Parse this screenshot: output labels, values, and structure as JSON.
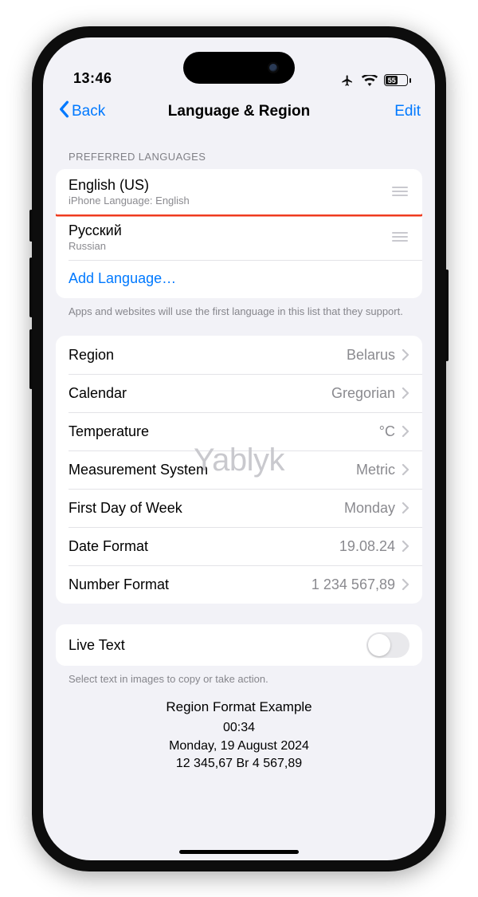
{
  "status": {
    "time": "13:46",
    "battery_pct": "55"
  },
  "nav": {
    "back": "Back",
    "title": "Language & Region",
    "edit": "Edit"
  },
  "languages": {
    "header": "PREFERRED LANGUAGES",
    "items": [
      {
        "title": "English (US)",
        "subtitle": "iPhone Language: English"
      },
      {
        "title": "Русский",
        "subtitle": "Russian"
      }
    ],
    "add": "Add Language…",
    "footer": "Apps and websites will use the first language in this list that they support."
  },
  "settings": [
    {
      "label": "Region",
      "value": "Belarus"
    },
    {
      "label": "Calendar",
      "value": "Gregorian"
    },
    {
      "label": "Temperature",
      "value": "°C"
    },
    {
      "label": "Measurement System",
      "value": "Metric"
    },
    {
      "label": "First Day of Week",
      "value": "Monday"
    },
    {
      "label": "Date Format",
      "value": "19.08.24"
    },
    {
      "label": "Number Format",
      "value": "1 234 567,89"
    }
  ],
  "livetext": {
    "label": "Live Text",
    "footer": "Select text in images to copy or take action."
  },
  "example": {
    "title": "Region Format Example",
    "time": "00:34",
    "date": "Monday, 19 August 2024",
    "currency": "12 345,67 Br   4 567,89"
  },
  "watermark": "Yablyk"
}
